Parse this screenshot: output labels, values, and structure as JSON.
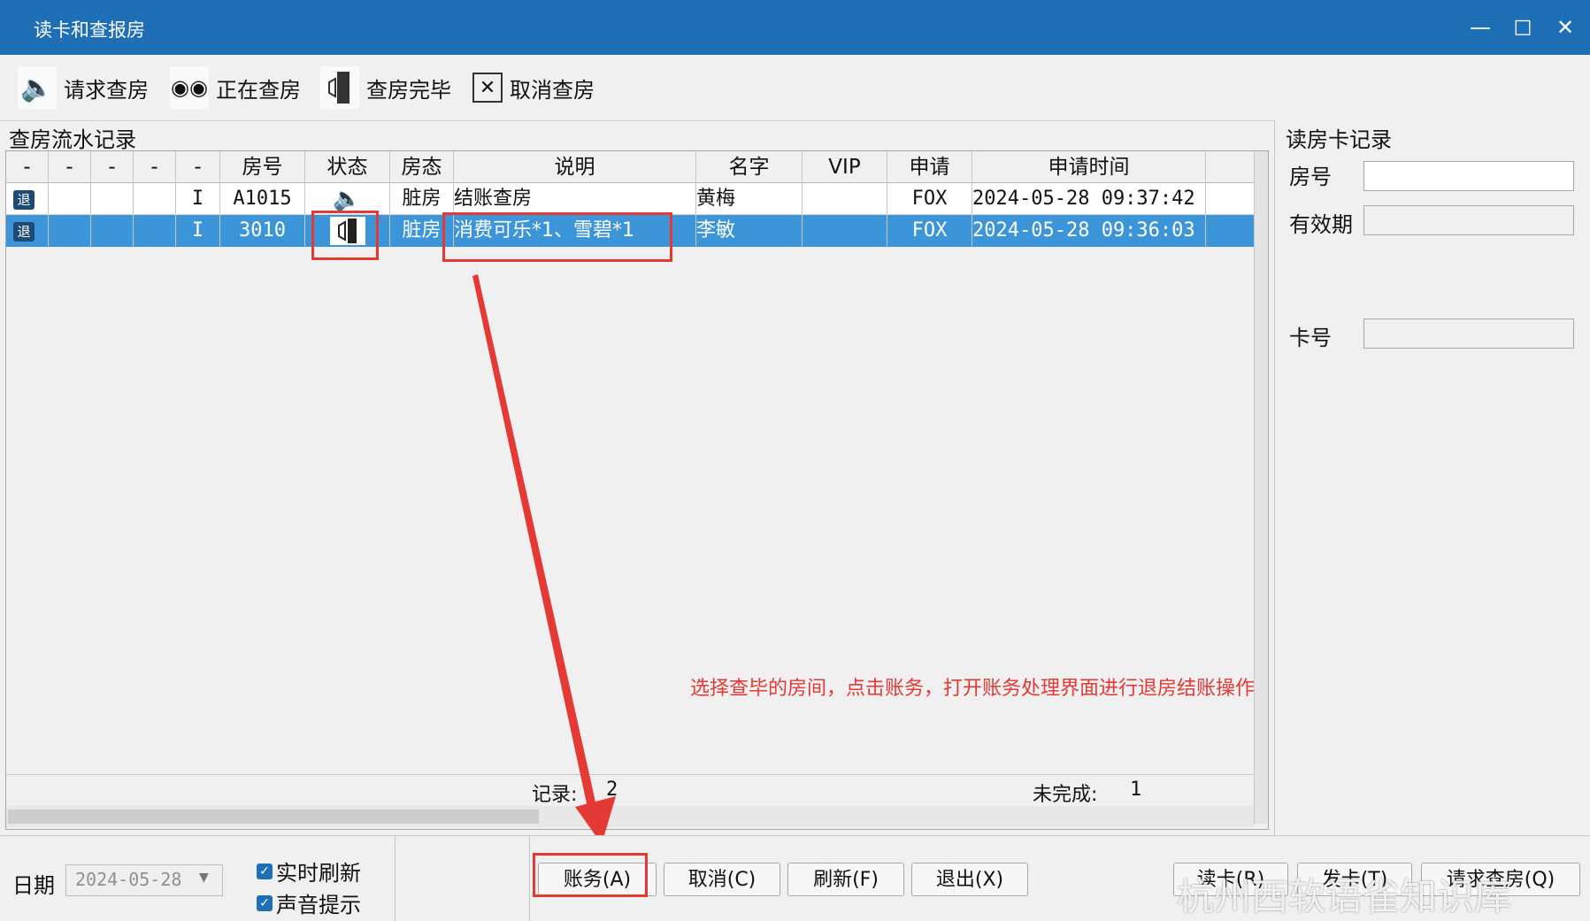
{
  "window": {
    "title": "读卡和查报房",
    "controls": [
      "minimize-icon",
      "maximize-icon",
      "close-icon"
    ]
  },
  "toolbar": {
    "request_label": "请求查房",
    "checking_label": "正在查房",
    "done_label": "查房完毕",
    "cancel_label": "取消查房"
  },
  "log": {
    "title": "查房流水记录",
    "columns": [
      "-",
      "-",
      "-",
      "-",
      "-",
      "房号",
      "状态",
      "房态",
      "说明",
      "名字",
      "VIP",
      "申请",
      "申请时间"
    ],
    "rows": [
      {
        "badge": "退",
        "flag": "I",
        "room": "A1015",
        "status_icon": "speaker-icon",
        "room_state": "脏房",
        "desc": "结账查房",
        "name": "黄梅",
        "vip": "",
        "applicant": "FOX",
        "time": "2024-05-28 09:37:42"
      },
      {
        "badge": "退",
        "flag": "I",
        "room": "3010",
        "status_icon": "door-done-icon",
        "room_state": "脏房",
        "desc": "消费可乐*1、雪碧*1",
        "name": "李敏",
        "vip": "",
        "applicant": "FOX",
        "time": "2024-05-28 09:36:03"
      }
    ],
    "record_label": "记录:",
    "record_count": "2",
    "unfinished_label": "未完成:",
    "unfinished_count": "1"
  },
  "card_panel": {
    "title": "读房卡记录",
    "room_label": "房号",
    "valid_label": "有效期",
    "card_label": "卡号",
    "room_value": "",
    "valid_value": "",
    "card_value": ""
  },
  "bottom": {
    "date_label": "日期",
    "date_value": "2024-05-28",
    "realtime_label": "实时刷新",
    "realtime_checked": true,
    "sound_label": "声音提示",
    "sound_checked": true,
    "account_btn": "账务(A)",
    "cancel_btn": "取消(C)",
    "refresh_btn": "刷新(F)",
    "exit_btn": "退出(X)",
    "read_card_btn": "读卡(R)",
    "issue_card_btn": "发卡(T)",
    "request_check_btn": "请求查房(Q)"
  },
  "annotation": {
    "text": "选择查毕的房间，点击账务，打开账务处理界面进行退房结账操作",
    "color": "#e53935"
  },
  "watermark": "杭州西软语雀知识库",
  "colors": {
    "titlebar": "#1f6fb7",
    "selection": "#3c95d8",
    "highlight": "#e53935"
  }
}
